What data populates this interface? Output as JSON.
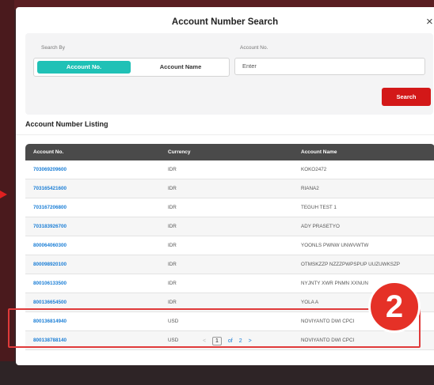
{
  "modal": {
    "title": "Account Number Search",
    "close": "×"
  },
  "search": {
    "search_by_label": "Search By",
    "toggle_account_no": "Account No.",
    "toggle_account_name": "Account Name",
    "account_no_label": "Account No.",
    "account_no_placeholder": "Enter",
    "search_button": "Search"
  },
  "listing": {
    "title": "Account Number Listing",
    "headers": [
      "Account No.",
      "Currency",
      "Account Name"
    ],
    "rows": [
      [
        "703069209600",
        "IDR",
        "KOKO2472"
      ],
      [
        "703165421600",
        "IDR",
        "RIANA2"
      ],
      [
        "703167206800",
        "IDR",
        "TEGUH TEST 1"
      ],
      [
        "703183926700",
        "IDR",
        "ADY PRASETYO"
      ],
      [
        "800064060300",
        "IDR",
        "YOONLS PWNW UNWVWTW"
      ],
      [
        "800098920100",
        "IDR",
        "OTMSKZZP NZZZPWPSPUP UUZUWKSZP"
      ],
      [
        "800106133500",
        "IDR",
        "NYJNTY XWR PNMN XXNUN"
      ],
      [
        "800136654500",
        "IDR",
        "YOLA A"
      ],
      [
        "800136814940",
        "USD",
        "NOVIYANTO DWI CPCI"
      ],
      [
        "800138788140",
        "USD",
        "NOVIYANTO DWI CPCI"
      ]
    ]
  },
  "pagination": {
    "prev": "<",
    "current": "1",
    "of": "of",
    "total": "2",
    "next": ">"
  },
  "callout_badge": "2",
  "colors": {
    "accent_teal": "#1fc1b6",
    "primary_red": "#d31818",
    "link_blue": "#1a7ed6",
    "header_dark": "#4a4a4a"
  }
}
